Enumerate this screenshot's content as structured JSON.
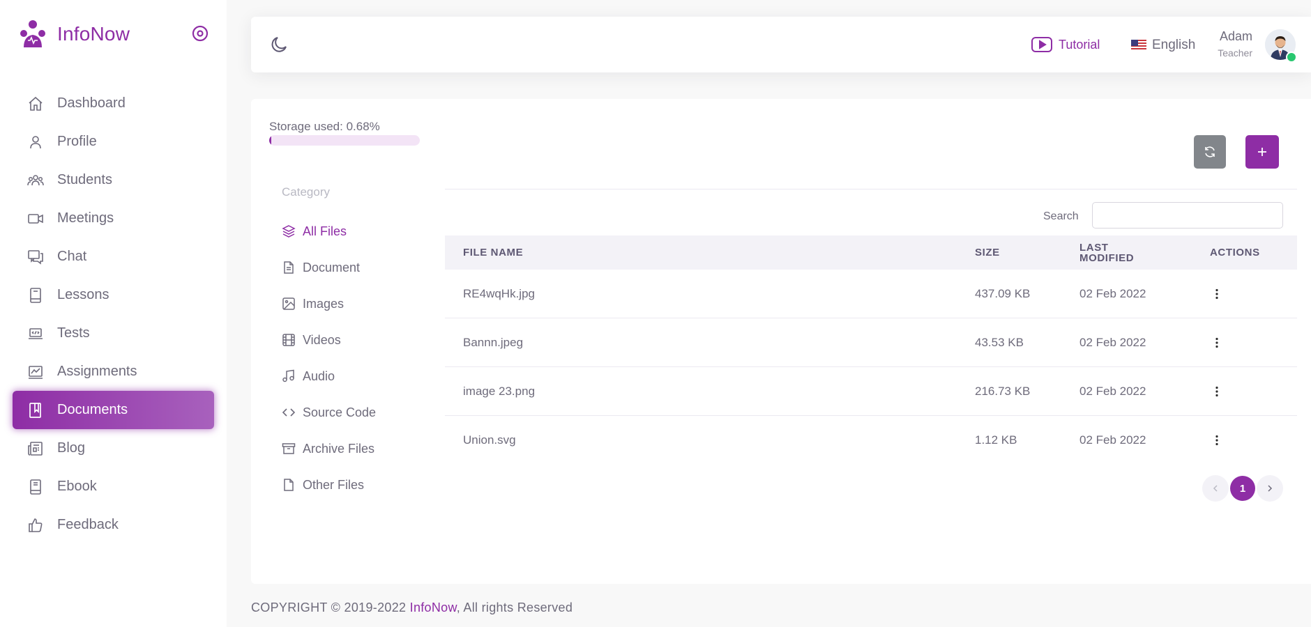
{
  "brand": {
    "name": "InfoNow",
    "color": "#8e2da5"
  },
  "sidebar": {
    "items": [
      {
        "label": "Dashboard",
        "icon": "home-icon"
      },
      {
        "label": "Profile",
        "icon": "user-icon"
      },
      {
        "label": "Students",
        "icon": "users-icon"
      },
      {
        "label": "Meetings",
        "icon": "video-icon"
      },
      {
        "label": "Chat",
        "icon": "chat-icon"
      },
      {
        "label": "Lessons",
        "icon": "book-icon"
      },
      {
        "label": "Tests",
        "icon": "laptop-code-icon"
      },
      {
        "label": "Assignments",
        "icon": "chart-board-icon"
      },
      {
        "label": "Documents",
        "icon": "document-book-icon",
        "active": true
      },
      {
        "label": "Blog",
        "icon": "newspaper-icon"
      },
      {
        "label": "Ebook",
        "icon": "ebook-icon"
      },
      {
        "label": "Feedback",
        "icon": "thumbs-up-icon"
      }
    ]
  },
  "navbar": {
    "tutorial_label": "Tutorial",
    "language": "English",
    "user_name": "Adam",
    "user_role": "Teacher"
  },
  "storage": {
    "label": "Storage used: 0.68%",
    "used_percent": 0.68
  },
  "category": {
    "title": "Category",
    "items": [
      {
        "label": "All Files",
        "icon": "layers-icon",
        "active": true
      },
      {
        "label": "Document",
        "icon": "file-text-icon"
      },
      {
        "label": "Images",
        "icon": "image-icon"
      },
      {
        "label": "Videos",
        "icon": "film-icon"
      },
      {
        "label": "Audio",
        "icon": "music-icon"
      },
      {
        "label": "Source Code",
        "icon": "code-icon"
      },
      {
        "label": "Archive Files",
        "icon": "archive-icon"
      },
      {
        "label": "Other Files",
        "icon": "file-icon"
      }
    ]
  },
  "search": {
    "label": "Search",
    "value": "",
    "placeholder": ""
  },
  "table": {
    "headers": {
      "name": "FILE NAME",
      "size": "SIZE",
      "modified_1": "LAST",
      "modified_2": "MODIFIED",
      "actions": "ACTIONS"
    },
    "rows": [
      {
        "name": "RE4wqHk.jpg",
        "size": "437.09 KB",
        "modified": "02 Feb 2022"
      },
      {
        "name": "Bannn.jpeg",
        "size": "43.53 KB",
        "modified": "02 Feb 2022"
      },
      {
        "name": "image 23.png",
        "size": "216.73 KB",
        "modified": "02 Feb 2022"
      },
      {
        "name": "Union.svg",
        "size": "1.12 KB",
        "modified": "02 Feb 2022"
      }
    ]
  },
  "pagination": {
    "current": "1"
  },
  "footer": {
    "prefix": "COPYRIGHT © 2019-2022 ",
    "brand": "InfoNow",
    "suffix": ", All rights Reserved"
  }
}
